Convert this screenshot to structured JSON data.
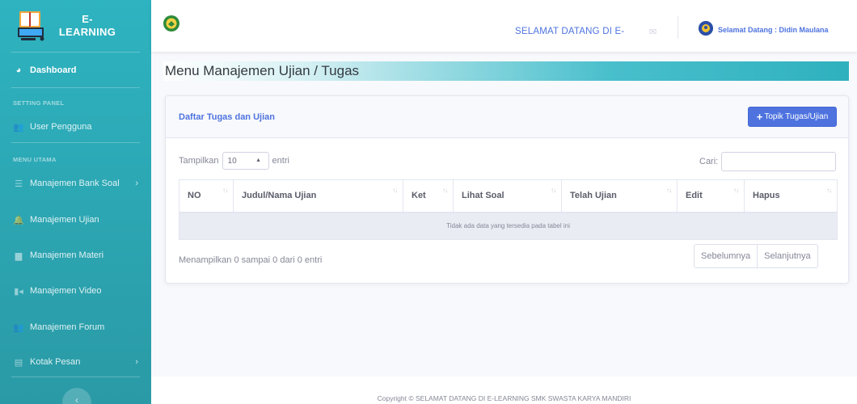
{
  "sidebar": {
    "brand": "E-LEARNING",
    "dashboard": "Dashboard",
    "section_setting": "SETTING PANEL",
    "user": "User Pengguna",
    "section_menu": "MENU UTAMA",
    "bank_soal": "Manajemen Bank Soal",
    "ujian": "Manajemen Ujian",
    "materi": "Manajemen Materi",
    "video": "Manajemen Video",
    "forum": "Manajemen Forum",
    "pesan": "Kotak Pesan"
  },
  "topbar": {
    "welcome": "SELAMAT DATANG DI E-",
    "user_greeting": "Selamat Datang : Didin Maulana"
  },
  "page": {
    "heading": "Menu Manajemen Ujian / Tugas"
  },
  "card": {
    "title": "Daftar Tugas dan Ujian",
    "add_button": "Topik Tugas/Ujian",
    "show_label": "Tampilkan",
    "entries_value": "10",
    "entries_label": "entri",
    "search_label": "Cari:",
    "columns": [
      "NO",
      "Judul/Nama Ujian",
      "Ket",
      "Lihat Soal",
      "Telah Ujian",
      "Edit",
      "Hapus"
    ],
    "empty_message": "Tidak ada data yang tersedia pada tabel ini",
    "info": "Menampilkan 0 sampai 0 dari 0 entri",
    "prev": "Sebelumnya",
    "next": "Selanjutnya"
  },
  "footer": {
    "copyright": "Copyright © SELAMAT DATANG DI E-LEARNING SMK SWASTA KARYA MANDIRI"
  },
  "colors": {
    "accent": "#4e73df",
    "sidebar": "#2eb3c0"
  }
}
